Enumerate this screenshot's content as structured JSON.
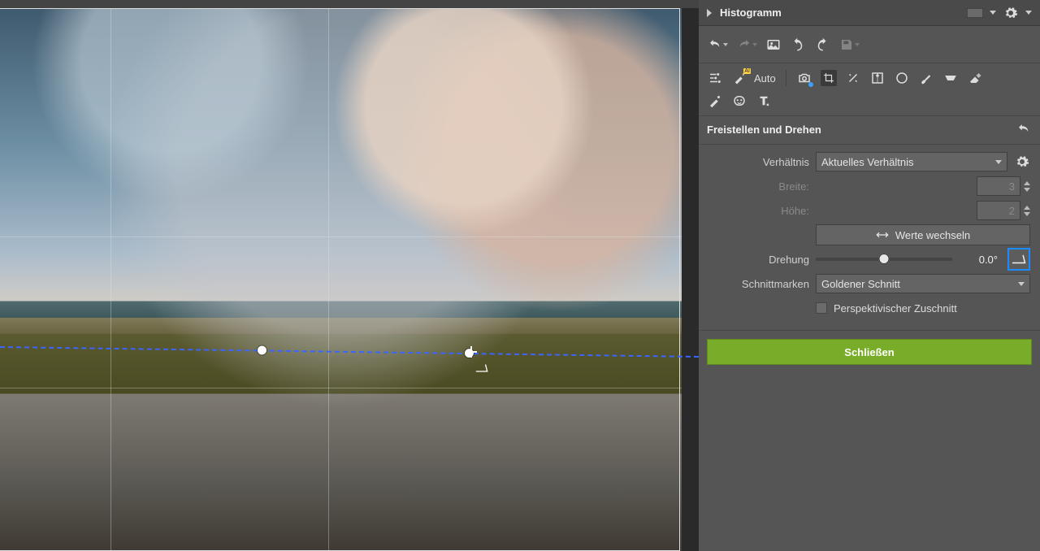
{
  "histogram": {
    "title": "Histogramm"
  },
  "toolbar": {
    "auto_label": "Auto"
  },
  "crop_panel": {
    "title": "Freistellen und Drehen",
    "ratio_label": "Verhältnis",
    "ratio_value": "Aktuelles Verhältnis",
    "width_label": "Breite:",
    "width_value": "3",
    "height_label": "Höhe:",
    "height_value": "2",
    "swap_label": "Werte wechseln",
    "rotation_label": "Drehung",
    "rotation_value": "0.0°",
    "cropmarks_label": "Schnittmarken",
    "cropmarks_value": "Goldener Schnitt",
    "perspective_label": "Perspektivischer Zuschnitt",
    "close_button": "Schließen"
  }
}
